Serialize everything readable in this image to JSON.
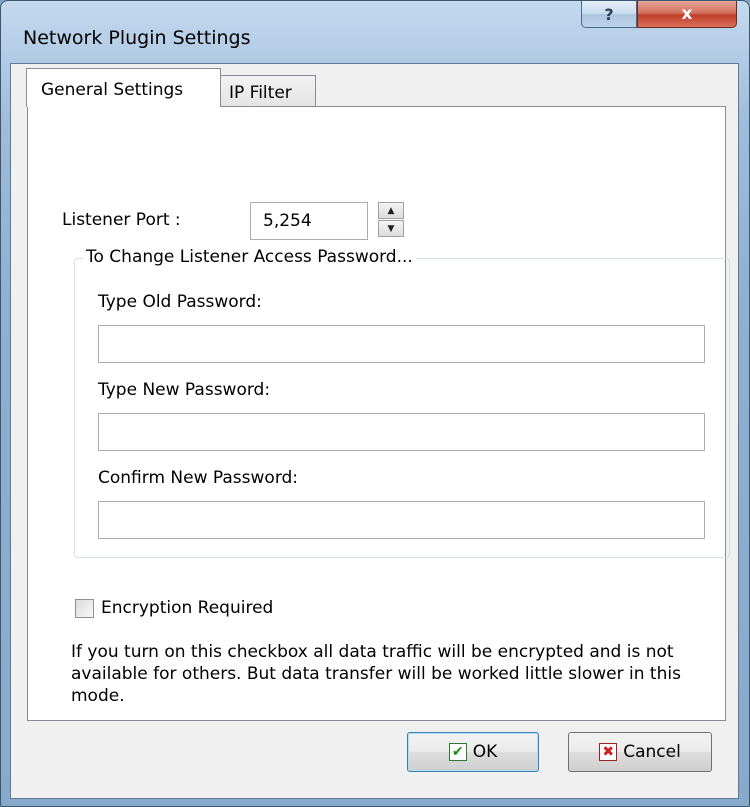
{
  "window": {
    "title": "Network Plugin Settings",
    "help_glyph": "?",
    "close_glyph": "x"
  },
  "tabs": [
    {
      "label": "General Settings",
      "active": true
    },
    {
      "label": "IP Filter",
      "active": false
    }
  ],
  "general": {
    "listener_port_label": "Listener Port :",
    "listener_port_value": "5,254",
    "spin_up_glyph": "▲",
    "spin_down_glyph": "▼",
    "password_group_title": "To Change Listener Access Password...",
    "old_password_label": "Type Old Password:",
    "old_password_value": "",
    "new_password_label": "Type New Password:",
    "new_password_value": "",
    "confirm_password_label": "Confirm New Password:",
    "confirm_password_value": "",
    "encryption_label": "Encryption Required",
    "encryption_checked": false,
    "encryption_description": "If you turn on this checkbox all data traffic will be encrypted and is not available for  others. But data transfer will be worked little slower in this mode."
  },
  "buttons": {
    "ok_label": "OK",
    "ok_icon": "checkmark-icon",
    "ok_glyph": "✔",
    "cancel_label": "Cancel",
    "cancel_icon": "x-mark-icon",
    "cancel_glyph": "✖"
  },
  "colors": {
    "titlebar": "#b9d1ea",
    "close_button": "#c8452f",
    "panel": "#ffffff"
  }
}
